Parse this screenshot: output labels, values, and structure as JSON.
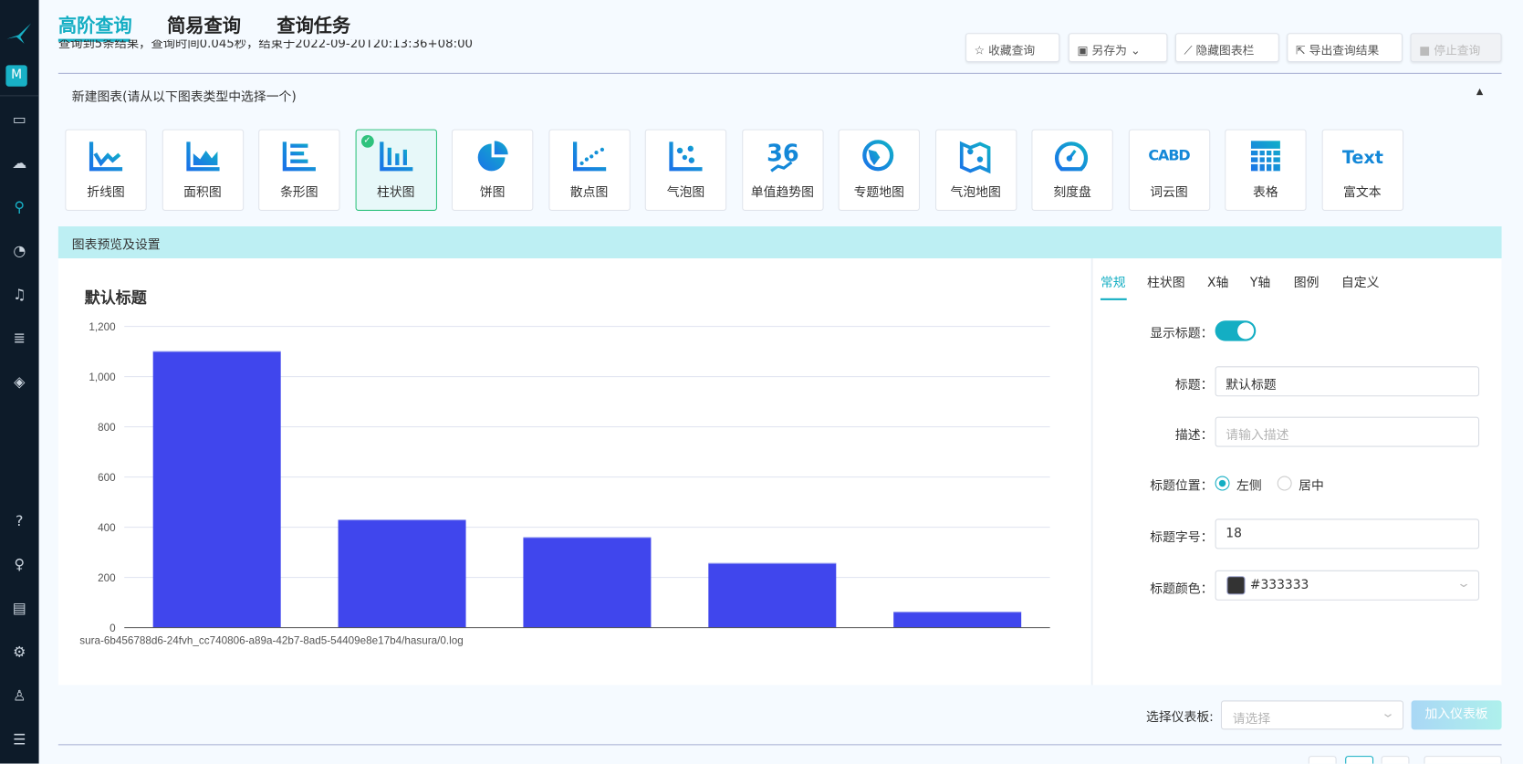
{
  "sidebar": {
    "avatar_letter": "M",
    "icons": [
      "dashboard-icon",
      "upload-icon",
      "search-icon",
      "gauge-icon",
      "bell-icon",
      "database-icon",
      "layers-icon",
      "help-icon",
      "lightbulb-icon",
      "chat-icon",
      "gear-icon",
      "user-icon",
      "menu-indent-icon"
    ]
  },
  "header": {
    "tabs": [
      {
        "label": "高阶查询",
        "active": true
      },
      {
        "label": "简易查询"
      },
      {
        "label": "查询任务"
      }
    ],
    "summary": "查询到5条结果，查询时间0.045秒，结束于2022-09-20T20:13:36+08:00",
    "buttons": {
      "favorite": "收藏查询",
      "save_as": "另存为",
      "hide_chart": "隐藏图表栏",
      "export": "导出查询结果",
      "stop": "停止查询"
    }
  },
  "new_chart": {
    "title": "新建图表(请从以下图表类型中选择一个)",
    "types": [
      {
        "label": "折线图",
        "icon": "line-chart-icon"
      },
      {
        "label": "面积图",
        "icon": "area-chart-icon"
      },
      {
        "label": "条形图",
        "icon": "horizontal-bar-chart-icon"
      },
      {
        "label": "柱状图",
        "icon": "column-chart-icon",
        "selected": true
      },
      {
        "label": "饼图",
        "icon": "pie-chart-icon"
      },
      {
        "label": "散点图",
        "icon": "scatter-chart-icon"
      },
      {
        "label": "气泡图",
        "icon": "bubble-chart-icon"
      },
      {
        "label": "单值趋势图",
        "icon": "single-value-trend-icon",
        "icon_text": "36"
      },
      {
        "label": "专题地图",
        "icon": "globe-map-icon"
      },
      {
        "label": "气泡地图",
        "icon": "bubble-map-icon"
      },
      {
        "label": "刻度盘",
        "icon": "dial-gauge-icon"
      },
      {
        "label": "词云图",
        "icon": "word-cloud-icon",
        "icon_text": "CABD"
      },
      {
        "label": "表格",
        "icon": "table-icon"
      },
      {
        "label": "富文本",
        "icon": "rich-text-icon",
        "icon_text": "Text"
      }
    ]
  },
  "preview": {
    "title": "图表预览及设置"
  },
  "chart_data": {
    "type": "bar",
    "title": "默认标题",
    "categories": [
      "sura-6b456788d6-24fvh_cc740806-a89a-42b7-8ad5-54409e8e17b4/hasura/0.log",
      "",
      "",
      "",
      ""
    ],
    "values": [
      1100,
      429,
      359,
      256,
      62
    ],
    "ylim": [
      0,
      1200
    ],
    "yticks": [
      "0",
      "200",
      "400",
      "600",
      "800",
      "1,000",
      "1,200"
    ],
    "grid": true,
    "color": "#4046ed"
  },
  "settings": {
    "tabs": [
      {
        "label": "常规",
        "active": true
      },
      {
        "label": "柱状图"
      },
      {
        "label": "X轴"
      },
      {
        "label": "Y轴"
      },
      {
        "label": "图例"
      },
      {
        "label": "自定义"
      }
    ],
    "show_title_label": "显示标题：",
    "show_title": true,
    "title_label": "标题：",
    "title_value": "默认标题",
    "desc_label": "描述：",
    "desc_placeholder": "请输入描述",
    "position_label": "标题位置：",
    "position_options": [
      "左侧",
      "居中"
    ],
    "position_selected": "左侧",
    "font_size_label": "标题字号：",
    "font_size": "18",
    "color_label": "标题颜色：",
    "color_value": "#333333"
  },
  "footer": {
    "dashboard_label": "选择仪表板:",
    "dashboard_placeholder": "请选择",
    "add_button": "加入仪表板"
  },
  "colors": {
    "accent": "#14aec3",
    "bar": "#4046ed",
    "sidebar": "#0d1b29",
    "selected_card": "#2fc27d"
  }
}
